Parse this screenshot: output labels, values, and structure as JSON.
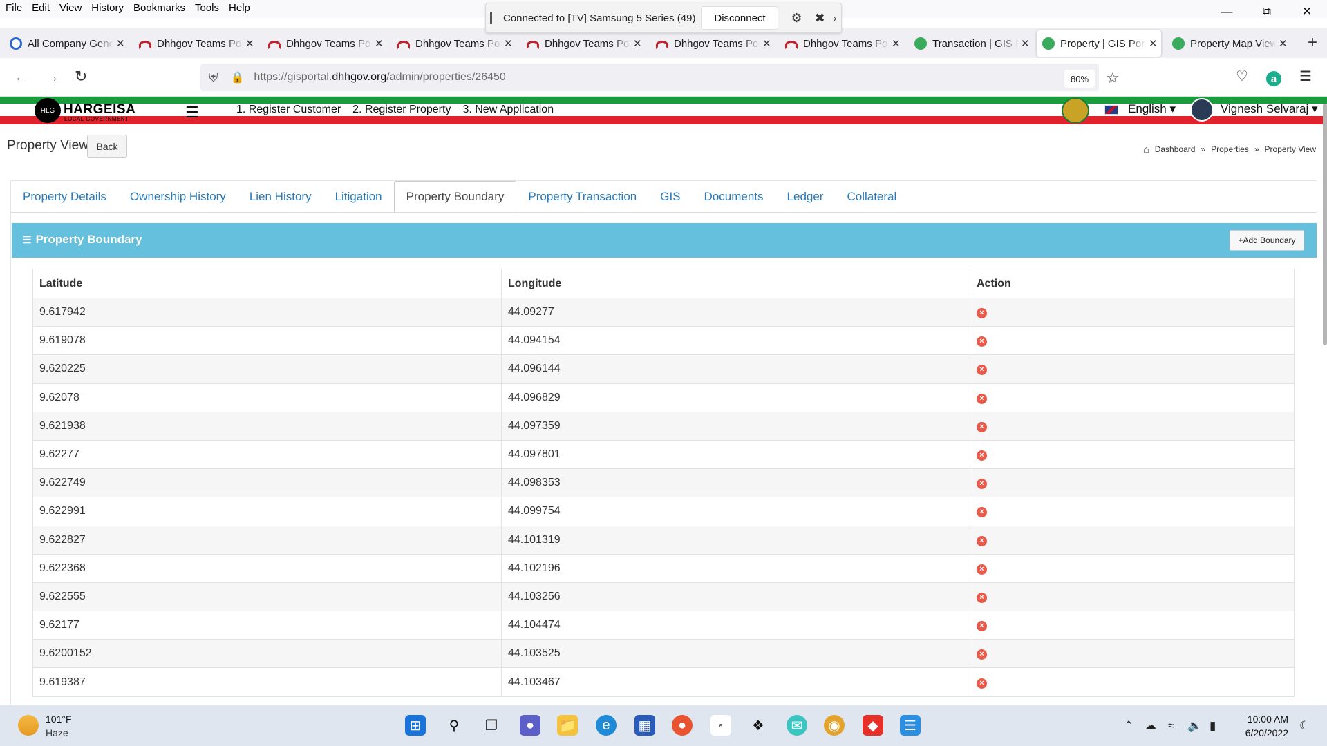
{
  "menubar": {
    "items": [
      "File",
      "Edit",
      "View",
      "History",
      "Bookmarks",
      "Tools",
      "Help"
    ]
  },
  "castbar": {
    "text": "Connected to [TV] Samsung 5 Series (49)",
    "disconnect_label": "Disconnect"
  },
  "tabs": [
    {
      "title": "All Company General",
      "favicon": "blue"
    },
    {
      "title": "Dhhgov Teams Portal",
      "favicon": "red"
    },
    {
      "title": "Dhhgov Teams Portal",
      "favicon": "red"
    },
    {
      "title": "Dhhgov Teams Portal",
      "favicon": "red"
    },
    {
      "title": "Dhhgov Teams Portal",
      "favicon": "red"
    },
    {
      "title": "Dhhgov Teams Portal",
      "favicon": "red"
    },
    {
      "title": "Dhhgov Teams Portal",
      "favicon": "red"
    },
    {
      "title": "Transaction | GIS Portal",
      "favicon": "green"
    },
    {
      "title": "Property | GIS Portal",
      "favicon": "green",
      "active": true
    },
    {
      "title": "Property Map View",
      "favicon": "green"
    }
  ],
  "address": {
    "prefix": "https://gisportal.",
    "domain": "dhhgov.org",
    "path": "/admin/properties/26450",
    "zoom": "80%"
  },
  "site": {
    "logo_text": "HARGEISA",
    "logo_sub": "LOCAL GOVERNMENT",
    "logo_badge": "HLG",
    "quick_links": [
      "1. Register Customer",
      "2. Register Property",
      "3. New Application"
    ],
    "language": "English",
    "user_name": "Vignesh Selvaraj"
  },
  "page": {
    "title": "Property View",
    "back_label": "Back",
    "breadcrumb": [
      "Dashboard",
      "Properties",
      "Property View"
    ],
    "breadcrumb_sep": "»"
  },
  "property_tabs": [
    "Property Details",
    "Ownership History",
    "Lien History",
    "Litigation",
    "Property Boundary",
    "Property Transaction",
    "GIS",
    "Documents",
    "Ledger",
    "Collateral"
  ],
  "active_tab": "Property Boundary",
  "panel": {
    "title": "Property Boundary",
    "add_label": "+Add Boundary"
  },
  "table": {
    "headers": [
      "Latitude",
      "Longitude",
      "Action"
    ],
    "rows": [
      [
        "9.617942",
        "44.09277"
      ],
      [
        "9.619078",
        "44.094154"
      ],
      [
        "9.620225",
        "44.096144"
      ],
      [
        "9.62078",
        "44.096829"
      ],
      [
        "9.621938",
        "44.097359"
      ],
      [
        "9.62277",
        "44.097801"
      ],
      [
        "9.622749",
        "44.098353"
      ],
      [
        "9.622991",
        "44.099754"
      ],
      [
        "9.622827",
        "44.101319"
      ],
      [
        "9.622368",
        "44.102196"
      ],
      [
        "9.622555",
        "44.103256"
      ],
      [
        "9.62177",
        "44.104474"
      ],
      [
        "9.6200152",
        "44.103525"
      ],
      [
        "9.619387",
        "44.103467"
      ]
    ]
  },
  "taskbar": {
    "temperature": "101°F",
    "condition": "Haze",
    "time": "10:00 AM",
    "date": "6/20/2022"
  },
  "colors": {
    "panel_header": "#65c0dd",
    "tab_link": "#2a7ab8",
    "delete_icon": "#e85a4a",
    "flag_green": "#1a9b3c",
    "flag_red": "#e0222c"
  }
}
